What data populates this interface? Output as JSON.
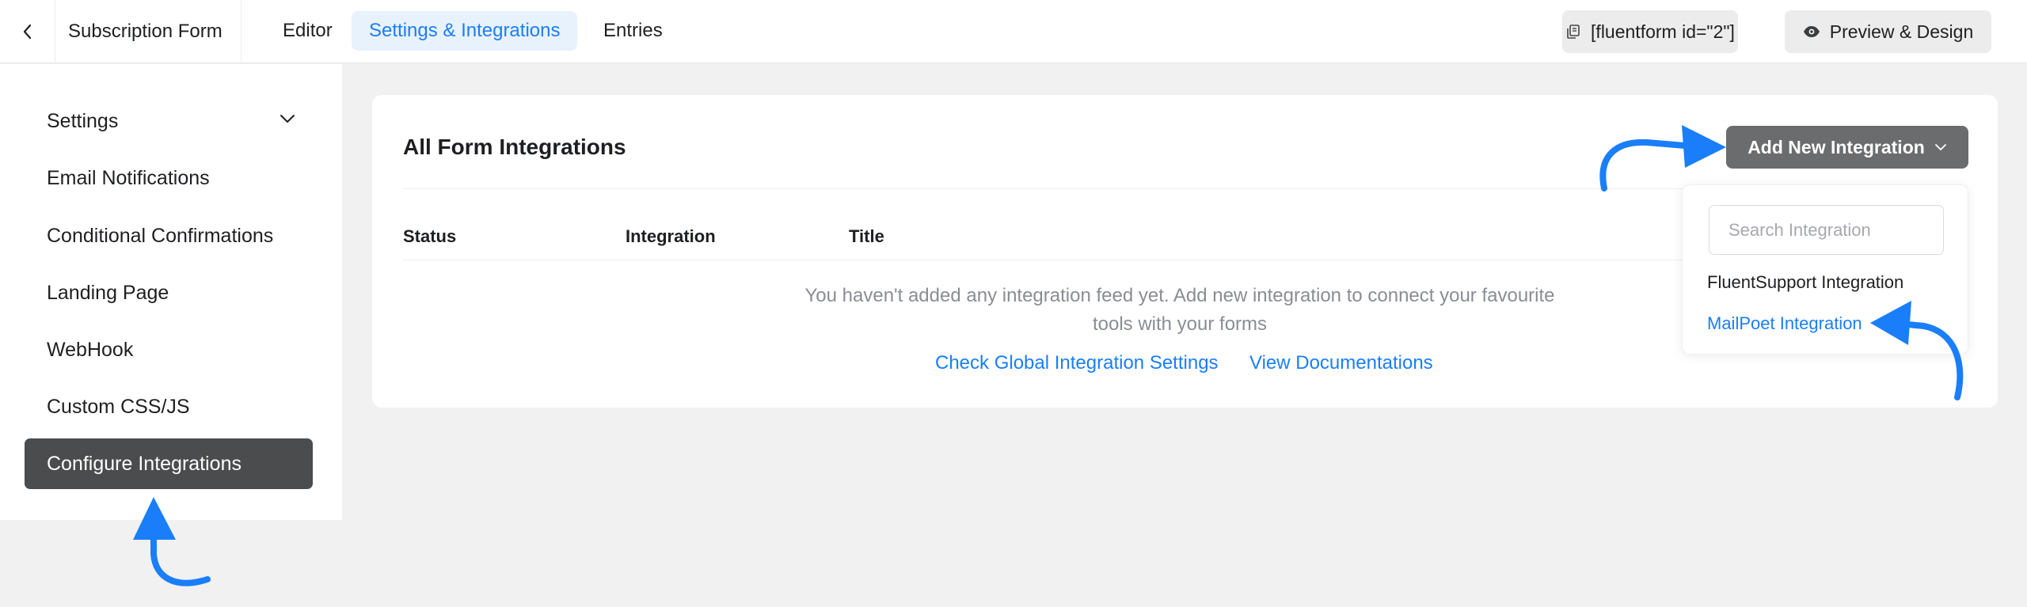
{
  "header": {
    "form_title": "Subscription Form",
    "tabs": [
      {
        "label": "Editor",
        "active": false
      },
      {
        "label": "Settings & Integrations",
        "active": true
      },
      {
        "label": "Entries",
        "active": false
      }
    ],
    "shortcode_label": "[fluentform id=\"2\"]",
    "preview_label": "Preview & Design"
  },
  "sidebar": {
    "items": [
      {
        "label": "Settings",
        "expandable": true
      },
      {
        "label": "Email Notifications"
      },
      {
        "label": "Conditional Confirmations"
      },
      {
        "label": "Landing Page"
      },
      {
        "label": "WebHook"
      },
      {
        "label": "Custom CSS/JS"
      },
      {
        "label": "Configure Integrations",
        "active": true
      }
    ]
  },
  "main": {
    "title": "All Form Integrations",
    "add_button_label": "Add New Integration",
    "columns": [
      "Status",
      "Integration",
      "Title"
    ],
    "empty_message": "You haven't added any integration feed yet. Add new integration to connect your favourite tools with your forms",
    "links": {
      "global_settings": "Check Global Integration Settings",
      "documentation": "View Documentations"
    }
  },
  "dropdown": {
    "search_placeholder": "Search Integration",
    "options": [
      {
        "label": "FluentSupport Integration"
      },
      {
        "label": "MailPoet Integration",
        "highlighted": true
      }
    ]
  },
  "colors": {
    "accent": "#1a7efb",
    "annotation_arrow": "#1a7efb",
    "sidebar_active_bg": "#4b4c4d",
    "add_button_bg": "#6b6c6d",
    "tab_active_bg": "#e8f2fd"
  },
  "icons": {
    "back": "chevron-left-icon",
    "shortcode": "copy-icon",
    "preview": "eye-icon",
    "settings_expand": "chevron-down-icon",
    "add_dropdown": "chevron-down-icon"
  }
}
